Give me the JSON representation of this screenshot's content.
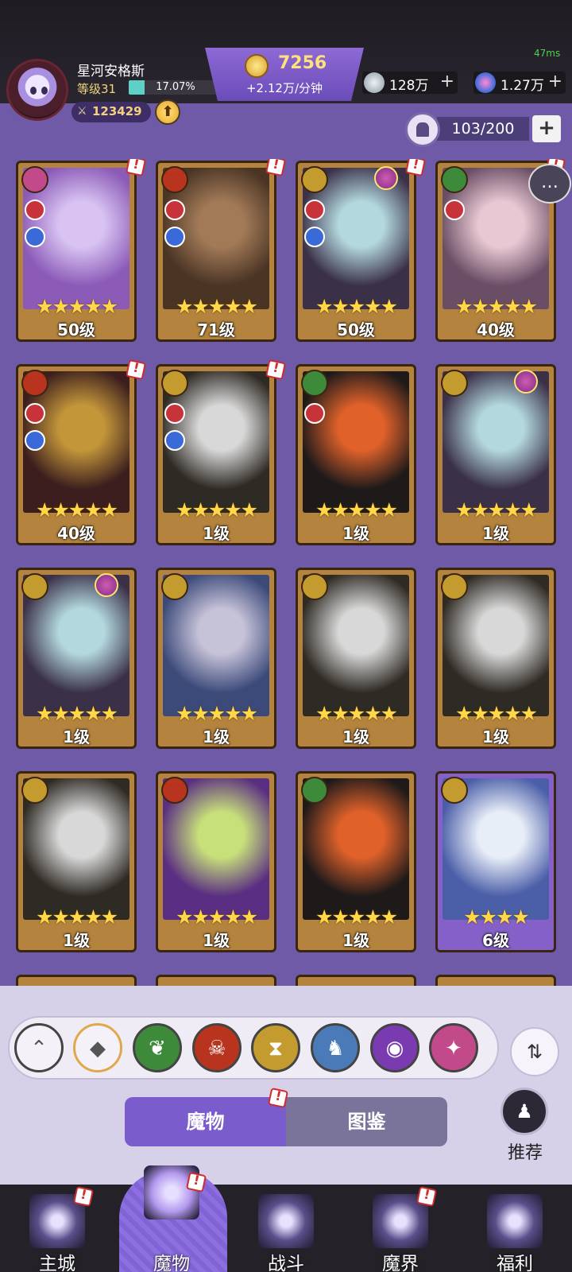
{
  "player": {
    "name": "星河安格斯",
    "level_label": "等级31",
    "exp_percent_text": "17.07%",
    "exp_fraction": 0.1707,
    "power": "123429"
  },
  "currency": {
    "gold": "7256",
    "gold_rate": "+2.12万/分钟",
    "silver": "128万",
    "gems": "1.27万"
  },
  "ping": "47ms",
  "monster_count": "103/200",
  "cards": [
    {
      "level": "50级",
      "stars": 5,
      "frame": "gold",
      "faction_color": "#c24a8a",
      "art": [
        "#8c5bb8",
        "#d8c3f2"
      ],
      "roles": 2,
      "skill": false,
      "alert": true
    },
    {
      "level": "71级",
      "stars": 5,
      "frame": "gold",
      "faction_color": "#b8341f",
      "art": [
        "#4a3424",
        "#a27a58"
      ],
      "roles": 2,
      "skill": false,
      "alert": true
    },
    {
      "level": "50级",
      "stars": 5,
      "frame": "gold",
      "faction_color": "#c49b2e",
      "art": [
        "#3a3048",
        "#b3d8de"
      ],
      "roles": 2,
      "skill": true,
      "alert": true
    },
    {
      "level": "40级",
      "stars": 5,
      "frame": "gold",
      "faction_color": "#3d8a3a",
      "art": [
        "#6a4e66",
        "#e8c8d2"
      ],
      "roles": 1,
      "skill": false,
      "alert": true
    },
    {
      "level": "40级",
      "stars": 5,
      "frame": "gold",
      "faction_color": "#b8341f",
      "art": [
        "#3c1e1e",
        "#c3963a"
      ],
      "roles": 2,
      "skill": false,
      "alert": true
    },
    {
      "level": "1级",
      "stars": 5,
      "frame": "gold",
      "faction_color": "#c49b2e",
      "art": [
        "#2e2a24",
        "#d8d8d8"
      ],
      "roles": 2,
      "skill": false,
      "alert": true
    },
    {
      "level": "1级",
      "stars": 5,
      "frame": "gold",
      "faction_color": "#3d8a3a",
      "art": [
        "#1f1a1a",
        "#e0622a"
      ],
      "roles": 1,
      "skill": false,
      "alert": false
    },
    {
      "level": "1级",
      "stars": 5,
      "frame": "gold",
      "faction_color": "#c49b2e",
      "art": [
        "#3a3048",
        "#b3d8de"
      ],
      "roles": 0,
      "skill": true,
      "alert": false
    },
    {
      "level": "1级",
      "stars": 5,
      "frame": "gold",
      "faction_color": "#c49b2e",
      "art": [
        "#3a3048",
        "#b3d8de"
      ],
      "roles": 0,
      "skill": true,
      "alert": false
    },
    {
      "level": "1级",
      "stars": 5,
      "frame": "gold",
      "faction_color": "#c49b2e",
      "art": [
        "#3c4a7a",
        "#c6c2d8"
      ],
      "roles": 0,
      "skill": false,
      "alert": false
    },
    {
      "level": "1级",
      "stars": 5,
      "frame": "gold",
      "faction_color": "#c49b2e",
      "art": [
        "#2e2a24",
        "#d8d8d8"
      ],
      "roles": 0,
      "skill": false,
      "alert": false
    },
    {
      "level": "1级",
      "stars": 5,
      "frame": "gold",
      "faction_color": "#c49b2e",
      "art": [
        "#2e2a24",
        "#d8d8d8"
      ],
      "roles": 0,
      "skill": false,
      "alert": false
    },
    {
      "level": "1级",
      "stars": 5,
      "frame": "gold",
      "faction_color": "#c49b2e",
      "art": [
        "#2e2a24",
        "#d8d8d8"
      ],
      "roles": 0,
      "skill": false,
      "alert": false
    },
    {
      "level": "1级",
      "stars": 5,
      "frame": "gold",
      "faction_color": "#b8341f",
      "art": [
        "#5a2e82",
        "#c8e07a"
      ],
      "roles": 0,
      "skill": false,
      "alert": false
    },
    {
      "level": "1级",
      "stars": 5,
      "frame": "gold",
      "faction_color": "#3d8a3a",
      "art": [
        "#1f1a1a",
        "#e0622a"
      ],
      "roles": 0,
      "skill": false,
      "alert": false
    },
    {
      "level": "6级",
      "stars": 4,
      "frame": "purple",
      "faction_color": "#c49b2e",
      "art": [
        "#4b5ea8",
        "#e8eef8"
      ],
      "roles": 0,
      "skill": false,
      "alert": false
    }
  ],
  "filters": [
    {
      "name": "collapse-filter-button",
      "icon": "⌃",
      "color": "#f4f2f8",
      "fg": "#555"
    },
    {
      "name": "all-factions-filter-button",
      "icon": "◆",
      "color": "#f4f2f8",
      "fg": "#555"
    },
    {
      "name": "nature-faction-filter-button",
      "icon": "❦",
      "color": "#3d8a3a",
      "fg": "#fff"
    },
    {
      "name": "demon-faction-filter-button",
      "icon": "☠",
      "color": "#b8341f",
      "fg": "#fff"
    },
    {
      "name": "time-faction-filter-button",
      "icon": "⧗",
      "color": "#c49b2e",
      "fg": "#fff"
    },
    {
      "name": "dragon-faction-filter-button",
      "icon": "♞",
      "color": "#4a7ab8",
      "fg": "#fff"
    },
    {
      "name": "eye-faction-filter-button",
      "icon": "◉",
      "color": "#7a3bb0",
      "fg": "#fff"
    },
    {
      "name": "star-faction-filter-button",
      "icon": "✦",
      "color": "#c24a8a",
      "fg": "#fff"
    }
  ],
  "sort_icon": "⇅",
  "tabs": {
    "monsters": "魔物",
    "codex": "图鉴"
  },
  "recommend_label": "推荐",
  "nav": [
    {
      "label": "主城",
      "icon": "castle-icon",
      "color": "#5a4e8a",
      "alert": true
    },
    {
      "label": "魔物",
      "icon": "flame-crystal-icon",
      "color": "#b49af0",
      "alert": true
    },
    {
      "label": "战斗",
      "icon": "sword-shield-icon",
      "color": "#5a4e8a",
      "alert": false
    },
    {
      "label": "魔界",
      "icon": "portal-icon",
      "color": "#5a4e8a",
      "alert": true
    },
    {
      "label": "福利",
      "icon": "treasure-chest-icon",
      "color": "#5a4e8a",
      "alert": false
    }
  ]
}
